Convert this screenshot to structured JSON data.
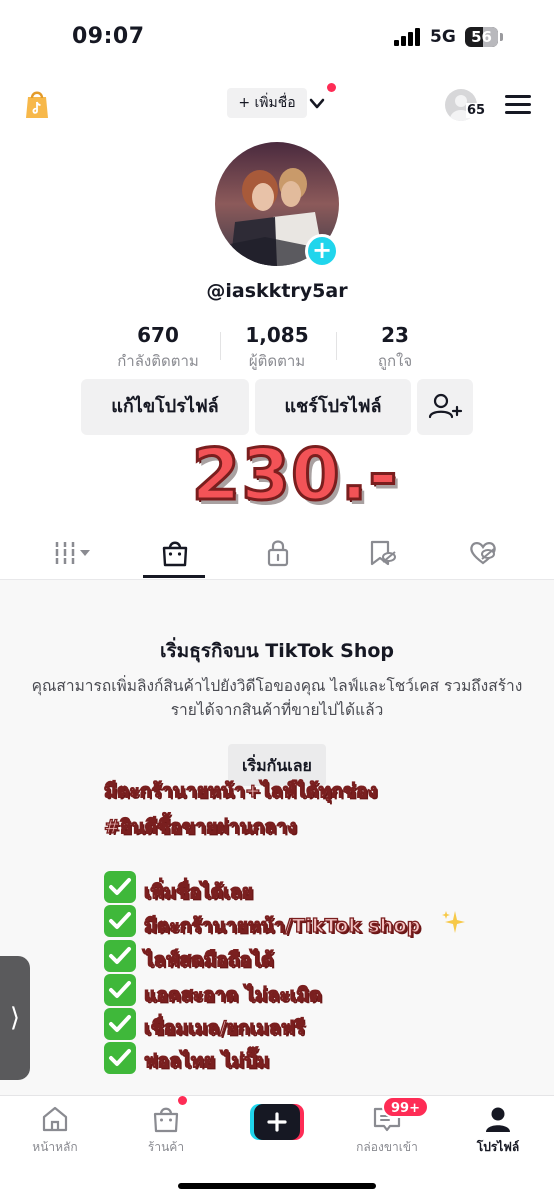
{
  "status_bar": {
    "time": "09:07",
    "network": "5G",
    "battery": "56",
    "battery_level": 0.56
  },
  "top_nav": {
    "add_name_label": "+ เพิ่มชื่อ",
    "notification_count": "65"
  },
  "profile": {
    "username": "@iaskktry5ar",
    "stats": [
      {
        "value": "670",
        "label": "กำลังติดตาม"
      },
      {
        "value": "1,085",
        "label": "ผู้ติดตาม"
      },
      {
        "value": "23",
        "label": "ถูกใจ"
      }
    ],
    "edit_profile_label": "แก้ไขโปรไฟล์",
    "share_profile_label": "แชร์โปรไฟล์"
  },
  "price_overlay": "230.-",
  "shop": {
    "title": "เริ่มธุรกิจบน TikTok Shop",
    "description": "คุณสามารถเพิ่มลิงก์สินค้าไปยังวิดีโอของคุณ ไลฟ์และโชว์เคส รวมถึงสร้างรายได้จากสินค้าที่ขายไปได้แล้ว",
    "start_label": "เริ่มกันเลย"
  },
  "promo": {
    "line1": "มีตะกร้านายหน้า+ไลฟ์ได้ทุกช่อง",
    "line2": "#ยินดีซื้อขายผ่านกลาง",
    "features": [
      "เพิ่มชื่อได้เลย",
      "มีตะกร้านายหน้า/TikTok shop",
      "ไลฟ์สดมือถือได้",
      "แอคสะอาด ไม่ละเมิด",
      "เชื่อมเมล/ยกเมลฟรี",
      "ฟอลไทย ไม่ปั๊ม"
    ]
  },
  "side_handle": "⟩",
  "bottom_nav": {
    "items": [
      {
        "label": "หน้าหลัก",
        "icon": "home-icon"
      },
      {
        "label": "ร้านค้า",
        "icon": "shop-bag-icon"
      },
      {
        "label": "กล่องขาเข้า",
        "icon": "inbox-icon"
      },
      {
        "label": "โปรไฟล์",
        "icon": "profile-icon"
      }
    ],
    "inbox_badge": "99+"
  },
  "colors": {
    "accent_red": "#fe2c55",
    "accent_cyan": "#20d5ec",
    "text_primary": "#161823",
    "price_red": "#f35357"
  }
}
